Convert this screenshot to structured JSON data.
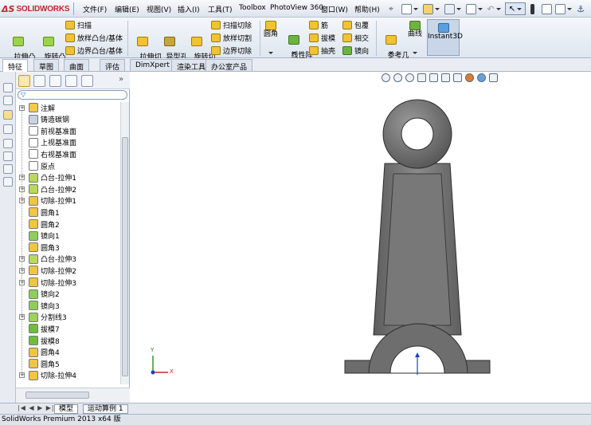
{
  "app": {
    "brand": "SOLIDWORKS",
    "status": "SolidWorks Premium 2013 x64 版"
  },
  "menu": [
    "文件(F)",
    "编辑(E)",
    "视图(V)",
    "插入(I)",
    "工具(T)",
    "Toolbox",
    "PhotoView 360",
    "窗口(W)",
    "帮助(H)"
  ],
  "ribbon": {
    "extrude_boss": "拉伸凸\n台/基体",
    "revolve_boss": "旋转凸\n台/基体",
    "sweep": "扫描",
    "loft_boss": "放样凸台/基体",
    "boundary_boss": "边界凸台/基体",
    "extrude_cut": "拉伸切\n除",
    "hole_wizard": "异型孔\n向导",
    "revolve_cut": "旋转切\n除",
    "swept_cut": "扫描切除",
    "lofted_cut": "放样切割",
    "boundary_cut": "边界切除",
    "fillet": "圆角",
    "linear_pattern": "线性阵\n列",
    "rib": "筋",
    "draft": "拔模",
    "shell": "抽壳",
    "wrap": "包覆",
    "intersect": "相交",
    "mirror": "镜向",
    "ref_geometry": "参考几\n何体",
    "curves": "曲线",
    "instant3d": "Instant3D"
  },
  "tabs": [
    "特征",
    "草图",
    "曲面",
    "评估",
    "DimXpert",
    "渲染工具",
    "办公室产品"
  ],
  "tree": [
    {
      "label": "注解",
      "expand": true,
      "icon": "annotations-icon"
    },
    {
      "label": "铸造碳钢",
      "expand": false,
      "icon": "material-icon"
    },
    {
      "label": "前视基准面",
      "expand": false,
      "icon": "plane-icon"
    },
    {
      "label": "上视基准面",
      "expand": false,
      "icon": "plane-icon"
    },
    {
      "label": "右视基准面",
      "expand": false,
      "icon": "plane-icon"
    },
    {
      "label": "原点",
      "expand": false,
      "icon": "origin-icon"
    },
    {
      "label": "凸台-拉伸1",
      "expand": true,
      "icon": "boss-extrude-icon"
    },
    {
      "label": "凸台-拉伸2",
      "expand": true,
      "icon": "boss-extrude-icon"
    },
    {
      "label": "切除-拉伸1",
      "expand": true,
      "icon": "cut-extrude-icon"
    },
    {
      "label": "圆角1",
      "expand": false,
      "icon": "fillet-icon"
    },
    {
      "label": "圆角2",
      "expand": false,
      "icon": "fillet-icon"
    },
    {
      "label": "镜向1",
      "expand": false,
      "icon": "mirror-icon"
    },
    {
      "label": "圆角3",
      "expand": false,
      "icon": "fillet-icon"
    },
    {
      "label": "凸台-拉伸3",
      "expand": true,
      "icon": "boss-extrude-icon"
    },
    {
      "label": "切除-拉伸2",
      "expand": true,
      "icon": "cut-extrude-icon"
    },
    {
      "label": "切除-拉伸3",
      "expand": true,
      "icon": "cut-extrude-icon"
    },
    {
      "label": "镜向2",
      "expand": false,
      "icon": "mirror-icon"
    },
    {
      "label": "镜向3",
      "expand": false,
      "icon": "mirror-icon"
    },
    {
      "label": "分割线3",
      "expand": true,
      "icon": "split-line-icon"
    },
    {
      "label": "拔模7",
      "expand": false,
      "icon": "draft-icon"
    },
    {
      "label": "拔模8",
      "expand": false,
      "icon": "draft-icon"
    },
    {
      "label": "圆角4",
      "expand": false,
      "icon": "fillet-icon"
    },
    {
      "label": "圆角5",
      "expand": false,
      "icon": "fillet-icon"
    },
    {
      "label": "切除-拉伸4",
      "expand": true,
      "icon": "cut-extrude-icon"
    }
  ],
  "bottom_tabs": [
    "模型",
    "运动算例 1"
  ],
  "axes": {
    "x": "X",
    "y": "Y"
  },
  "colors": {
    "part": "#7f7f7f",
    "accent": "#c1272d"
  }
}
